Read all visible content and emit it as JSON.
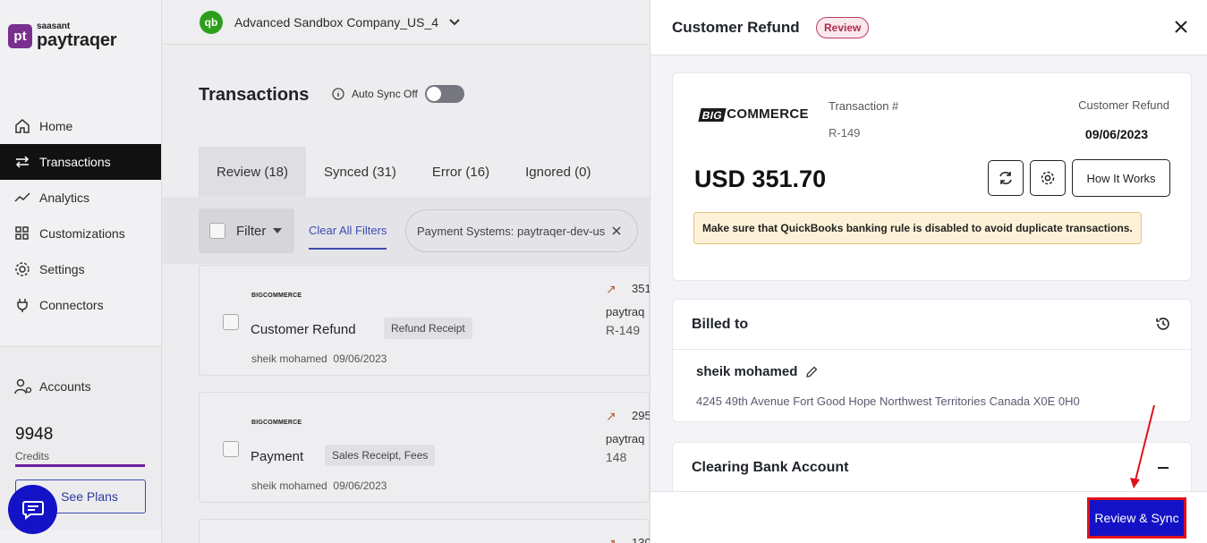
{
  "brand": {
    "small": "saasant",
    "big": "paytraqer",
    "mark": "pt"
  },
  "nav": [
    {
      "label": "Home",
      "icon": "home-icon",
      "active": false
    },
    {
      "label": "Transactions",
      "icon": "arrows-icon",
      "active": true
    },
    {
      "label": "Analytics",
      "icon": "chart-icon",
      "active": false
    },
    {
      "label": "Customizations",
      "icon": "grid-icon",
      "active": false
    },
    {
      "label": "Settings",
      "icon": "gear-icon",
      "active": false
    },
    {
      "label": "Connectors",
      "icon": "plug-icon",
      "active": false
    }
  ],
  "accounts": {
    "label": "Accounts",
    "credits_value": "9948",
    "credits_label": "Credits",
    "see_plans": "See Plans"
  },
  "topbar": {
    "company": "Advanced Sandbox Company_US_4",
    "qb_mark": "qb"
  },
  "main": {
    "title": "Transactions",
    "auto_sync_label": "Auto Sync Off",
    "tabs": [
      {
        "label": "Review (18)",
        "active": true
      },
      {
        "label": "Synced (31)",
        "active": false
      },
      {
        "label": "Error (16)",
        "active": false
      },
      {
        "label": "Ignored (0)",
        "active": false
      }
    ],
    "filter_label": "Filter",
    "clear_filters": "Clear All Filters",
    "chip": "Payment Systems: paytraqer-dev-us",
    "cards": [
      {
        "logo": "BIGCOMMERCE",
        "title": "Customer Refund",
        "tag": "Refund Receipt",
        "user": "sheik mohamed",
        "date": "09/06/2023",
        "amount": "351",
        "system": "paytraq",
        "ref": "R-149"
      },
      {
        "logo": "BIGCOMMERCE",
        "title": "Payment",
        "tag": "Sales Receipt, Fees",
        "user": "sheik mohamed",
        "date": "09/06/2023",
        "amount": "295",
        "system": "paytraq",
        "ref": "148"
      },
      {
        "amount": "130"
      }
    ]
  },
  "panel": {
    "title": "Customer Refund",
    "badge": "Review",
    "logo_tag": "BIG",
    "logo_rest": "COMMERCE",
    "txn_label": "Transaction #",
    "txn_value": "R-149",
    "type_label": "Customer Refund",
    "date": "09/06/2023",
    "amount": "USD 351.70",
    "how_it_works": "How It Works",
    "warning": "Make sure that QuickBooks banking rule is disabled to avoid duplicate transactions.",
    "billed_to_title": "Billed to",
    "customer_name": "sheik mohamed",
    "customer_address": "4245 49th Avenue Fort Good Hope Northwest Territories Canada X0E 0H0",
    "clearing_title": "Clearing Bank Account",
    "review_sync": "Review & Sync"
  },
  "colors": {
    "accent": "#1312c7",
    "brand": "#7a2f8f",
    "highlight": "#e0101a",
    "badge": "#b02a53"
  }
}
